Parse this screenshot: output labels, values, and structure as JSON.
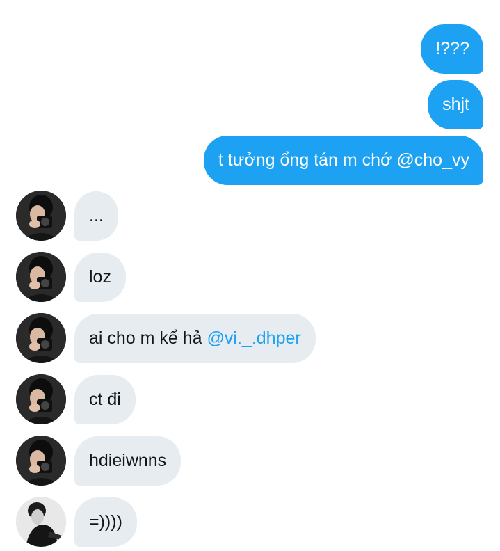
{
  "outgoing": [
    {
      "text": "!???"
    },
    {
      "text": "shjt"
    },
    {
      "text": "t tưởng ổng tán m chớ @cho_vy"
    }
  ],
  "incoming": [
    {
      "text": "..."
    },
    {
      "text": "loz"
    },
    {
      "text": "ai cho m kể hả ",
      "mention": "@vi._.dhper"
    },
    {
      "text": "ct đi"
    },
    {
      "text": "hdieiwnns"
    },
    {
      "text": "=))))"
    }
  ],
  "colors": {
    "outgoing_bubble": "#1da1f2",
    "incoming_bubble": "#e6ecf0",
    "mention": "#1da1f2"
  }
}
